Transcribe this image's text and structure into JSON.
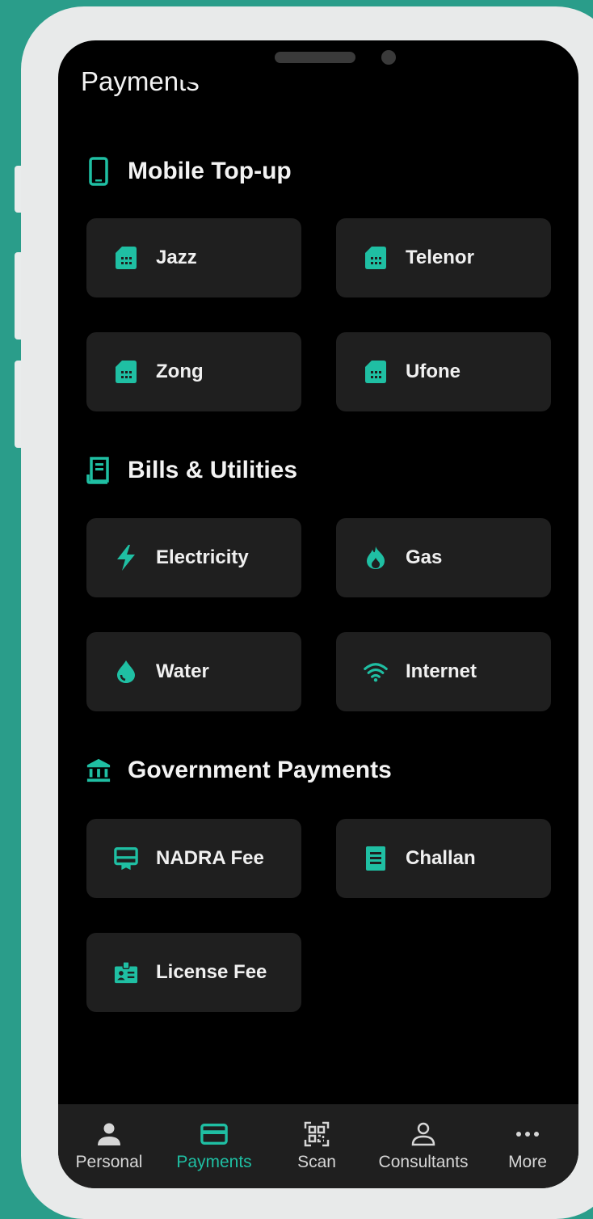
{
  "colors": {
    "accent": "#1fbfa3",
    "background": "#000000",
    "tile": "#1f1f1f",
    "frame": "#2a9d8a"
  },
  "page": {
    "title": "Payments"
  },
  "sections": {
    "mobile": {
      "title": "Mobile Top-up",
      "icon": "smartphone-icon",
      "items": [
        {
          "label": "Jazz",
          "icon": "sim-card-icon"
        },
        {
          "label": "Telenor",
          "icon": "sim-card-icon"
        },
        {
          "label": "Zong",
          "icon": "sim-card-icon"
        },
        {
          "label": "Ufone",
          "icon": "sim-card-icon"
        }
      ]
    },
    "bills": {
      "title": "Bills & Utilities",
      "icon": "receipt-icon",
      "items": [
        {
          "label": "Electricity",
          "icon": "bolt-icon"
        },
        {
          "label": "Gas",
          "icon": "flame-icon"
        },
        {
          "label": "Water",
          "icon": "water-drop-icon"
        },
        {
          "label": "Internet",
          "icon": "wifi-icon"
        }
      ]
    },
    "government": {
      "title": "Government Payments",
      "icon": "bank-icon",
      "items": [
        {
          "label": "NADRA Fee",
          "icon": "card-membership-icon"
        },
        {
          "label": "Challan",
          "icon": "document-list-icon"
        },
        {
          "label": "License Fee",
          "icon": "id-badge-icon"
        }
      ]
    }
  },
  "bottom_nav": {
    "active": "Payments",
    "items": [
      {
        "label": "Personal",
        "icon": "person-icon"
      },
      {
        "label": "Payments",
        "icon": "credit-card-icon"
      },
      {
        "label": "Scan",
        "icon": "qr-code-icon"
      },
      {
        "label": "Consultants",
        "icon": "person-outline-icon"
      },
      {
        "label": "More",
        "icon": "more-horizontal-icon"
      }
    ]
  }
}
